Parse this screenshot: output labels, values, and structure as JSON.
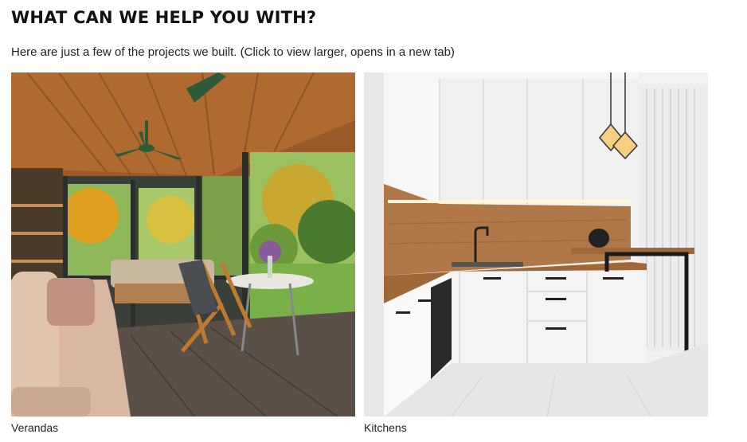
{
  "section": {
    "heading": "WHAT CAN WE HELP YOU WITH?",
    "intro": "Here are just a few of the projects we built. (Click to view larger, opens in a new tab)"
  },
  "gallery": [
    {
      "caption": "Verandas",
      "image": "veranda-interior-photo"
    },
    {
      "caption": "Kitchens",
      "image": "white-kitchen-photo"
    }
  ]
}
